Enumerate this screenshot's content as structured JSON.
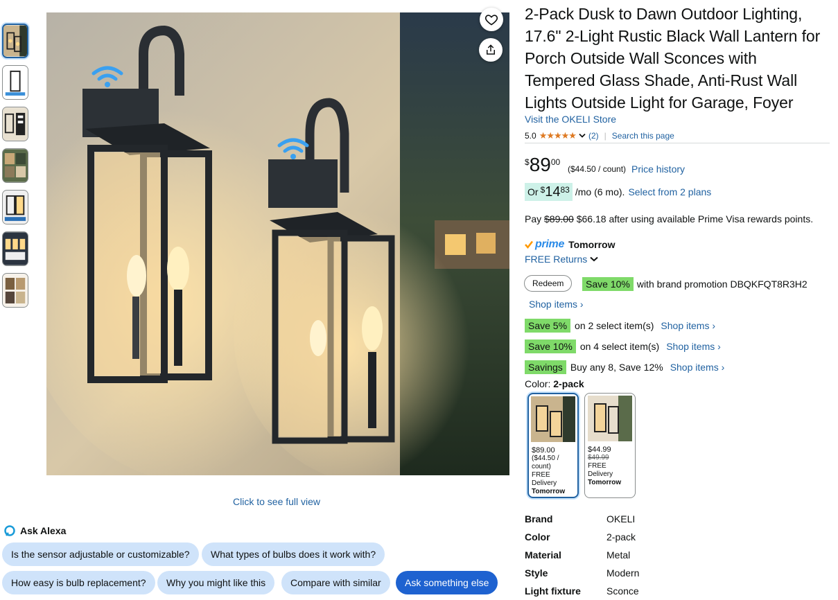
{
  "product": {
    "title": "2-Pack Dusk to Dawn Outdoor Lighting, 17.6\" 2-Light Rustic Black Wall Lantern for Porch Outside Wall Sconces with Tempered Glass Shade, Anti-Rust Wall Lights Outside Light for Garage, Foyer",
    "store_link": "Visit the OKELI Store",
    "rating": "5.0",
    "rating_stars": "★★★★★",
    "review_count": "(2)",
    "search_page": "Search this page"
  },
  "price": {
    "currency": "$",
    "whole": "89",
    "fraction": "00",
    "per_count": "($44.50 / count)",
    "history_link": "Price history"
  },
  "monthly": {
    "prefix": "Or",
    "currency": "$",
    "whole": "14",
    "fraction": "83",
    "term": "/mo (6 mo).",
    "plans_link": "Select from 2 plans"
  },
  "pay": {
    "prefix": "Pay",
    "original": "$89.00",
    "text": "$66.18 after using available Prime Visa rewards points."
  },
  "delivery": {
    "prime": "prime",
    "day": "Tomorrow",
    "returns": "FREE Returns"
  },
  "promotions": {
    "redeem": "Redeem",
    "brand_badge": "Save 10%",
    "brand_text": "with brand promotion DBQKFQT8R3H2",
    "brand_shop": "Shop items ›",
    "items": [
      {
        "badge": "Save 5%",
        "text": "on 2 select item(s)",
        "shop": "Shop items ›"
      },
      {
        "badge": "Save 10%",
        "text": "on 4 select item(s)",
        "shop": "Shop items ›"
      },
      {
        "badge": "Savings",
        "text": "Buy any 8, Save 12%",
        "shop": "Shop items ›"
      }
    ]
  },
  "color": {
    "label": "Color:",
    "selected": "2-pack",
    "options": [
      {
        "price": "$89.00",
        "per": "($44.50 / count)",
        "delivery": "FREE Delivery",
        "day": "Tomorrow"
      },
      {
        "price": "$44.99",
        "was": "$49.99",
        "delivery": "FREE Delivery",
        "day": "Tomorrow"
      }
    ]
  },
  "specs": [
    {
      "key": "Brand",
      "value": "OKELI"
    },
    {
      "key": "Color",
      "value": "2-pack"
    },
    {
      "key": "Material",
      "value": "Metal"
    },
    {
      "key": "Style",
      "value": "Modern"
    },
    {
      "key": "Light fixture",
      "value": "Sconce"
    }
  ],
  "gallery": {
    "click_full": "Click to see full view"
  },
  "alexa": {
    "title": "Ask Alexa",
    "chips": [
      "Is the sensor adjustable or customizable?",
      "What types of bulbs does it work with?",
      "How easy is bulb replacement?",
      "Why you might like this",
      "Compare with similar",
      "Ask something else"
    ]
  },
  "icons": {
    "wishlist": "heart-icon",
    "share": "share-icon",
    "alexa": "alexa-icon",
    "returns": "chevron-down-icon",
    "rating": "chevron-down-icon"
  },
  "colors": {
    "link": "#2162a1",
    "badge": "#7fda69",
    "monthly_highlight": "#cdf1e8",
    "star": "#de7921",
    "chip": "#cfe3fa",
    "chip_primary": "#1e62d0"
  }
}
